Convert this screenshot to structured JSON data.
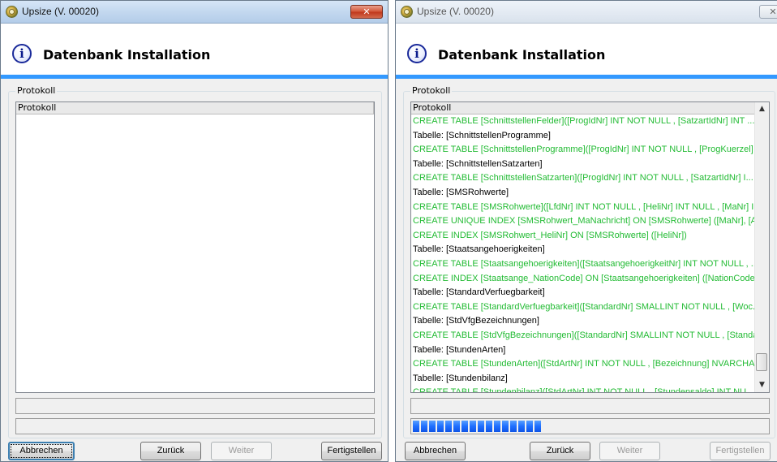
{
  "left_window": {
    "title": "Upsize (V. 00020)",
    "close_label": "✕",
    "header_title": "Datenbank Installation",
    "group_label": "Protokoll",
    "list_header": "Protokoll",
    "rows": [],
    "buttons": {
      "cancel": "Abbrechen",
      "back": "Zurück",
      "next": "Weiter",
      "finish": "Fertigstellen"
    }
  },
  "right_window": {
    "title": "Upsize (V. 00020)",
    "close_label": "✕",
    "header_title": "Datenbank Installation",
    "group_label": "Protokoll",
    "list_header": "Protokoll",
    "rows": [
      {
        "type": "sql",
        "text": "CREATE TABLE [SchnittstellenFelder]([ProgIdNr] INT NOT NULL , [SatzartIdNr] INT ..."
      },
      {
        "type": "table",
        "text": "Tabelle: [SchnittstellenProgramme]"
      },
      {
        "type": "sql",
        "text": "CREATE TABLE [SchnittstellenProgramme]([ProgIdNr] INT NOT NULL , [ProgKuerzel] ..."
      },
      {
        "type": "table",
        "text": "Tabelle: [SchnittstellenSatzarten]"
      },
      {
        "type": "sql",
        "text": "CREATE TABLE [SchnittstellenSatzarten]([ProgIdNr] INT NOT NULL , [SatzartIdNr] I..."
      },
      {
        "type": "table",
        "text": "Tabelle: [SMSRohwerte]"
      },
      {
        "type": "sql",
        "text": "CREATE TABLE [SMSRohwerte]([LfdNr] INT NOT NULL , [HeliNr] INT NULL , [MaNr] I..."
      },
      {
        "type": "sql",
        "text": "CREATE UNIQUE INDEX [SMSRohwert_MaNachricht] ON [SMSRohwerte] ([MaNr], [A..."
      },
      {
        "type": "sql",
        "text": "CREATE INDEX [SMSRohwert_HeliNr] ON [SMSRohwerte] ([HeliNr])"
      },
      {
        "type": "table",
        "text": "Tabelle: [Staatsangehoerigkeiten]"
      },
      {
        "type": "sql",
        "text": "CREATE TABLE [Staatsangehoerigkeiten]([StaatsangehoerigkeitNr] INT NOT NULL , ..."
      },
      {
        "type": "sql",
        "text": "CREATE INDEX [Staatsange_NationCode] ON [Staatsangehoerigkeiten] ([NationCode])"
      },
      {
        "type": "table",
        "text": "Tabelle: [StandardVerfuegbarkeit]"
      },
      {
        "type": "sql",
        "text": "CREATE TABLE [StandardVerfuegbarkeit]([StandardNr] SMALLINT NOT NULL , [Woc..."
      },
      {
        "type": "table",
        "text": "Tabelle: [StdVfgBezeichnungen]"
      },
      {
        "type": "sql",
        "text": "CREATE TABLE [StdVfgBezeichnungen]([StandardNr] SMALLINT NOT NULL , [Standa..."
      },
      {
        "type": "table",
        "text": "Tabelle: [StundenArten]"
      },
      {
        "type": "sql",
        "text": "CREATE TABLE [StundenArten]([StdArtNr] INT NOT NULL , [Bezeichnung] NVARCHA..."
      },
      {
        "type": "table",
        "text": "Tabelle: [Stundenbilanz]"
      },
      {
        "type": "sql",
        "text": "CREATE TABLE [Stundenbilanz]([StdArtNr] INT NOT NULL , [Stundensaldo] INT NU..."
      }
    ],
    "progress_segments": 16,
    "buttons": {
      "cancel": "Abbrechen",
      "back": "Zurück",
      "next": "Weiter",
      "finish": "Fertigstellen"
    }
  },
  "colors": {
    "accent": "#3399ff",
    "sql_text": "#22bb33",
    "progress": "#1f6fff"
  }
}
